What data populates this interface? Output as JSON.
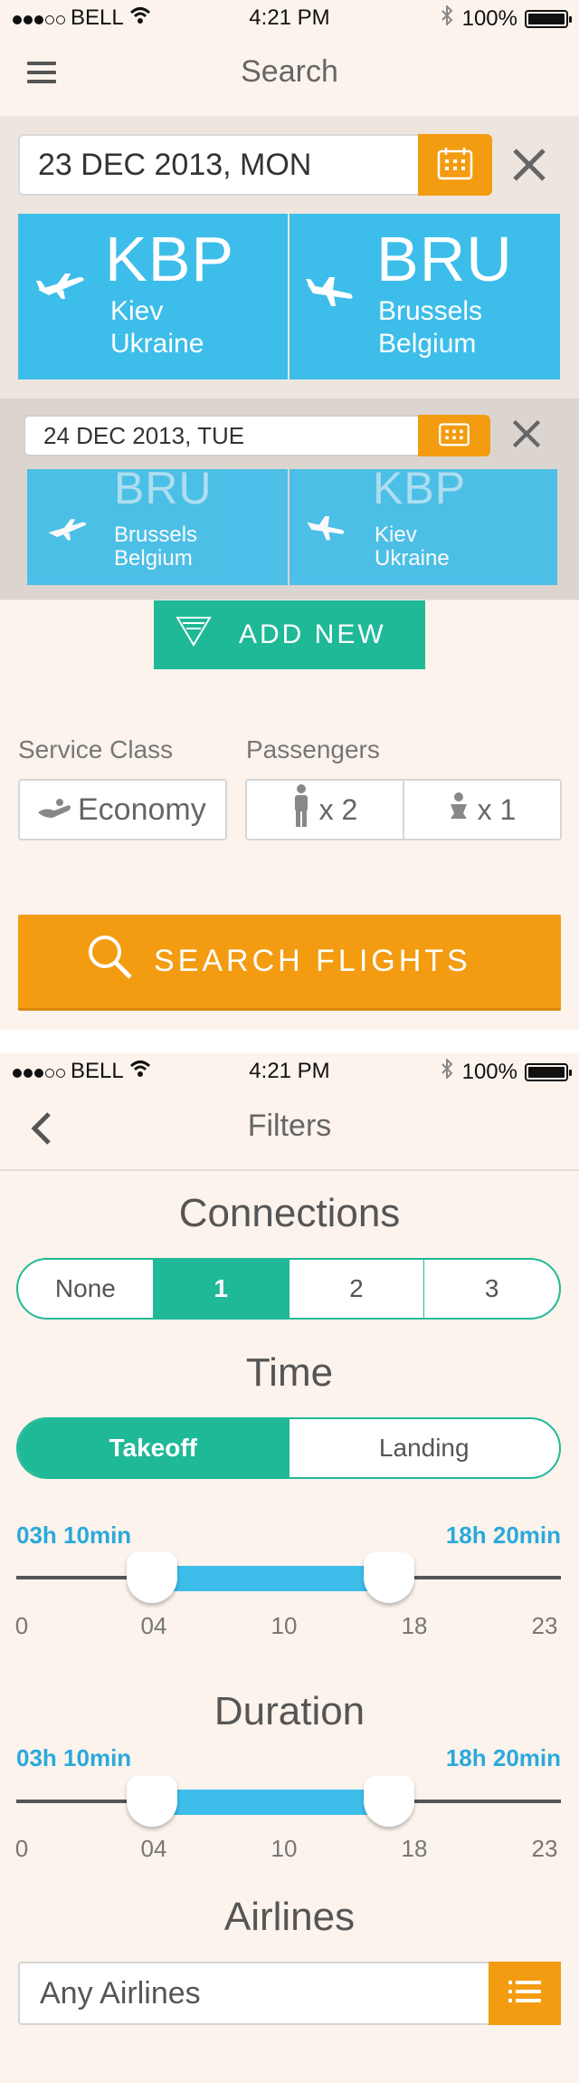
{
  "status_bar": {
    "carrier": "BELL",
    "time": "4:21 PM",
    "battery": "100%"
  },
  "search_screen": {
    "title": "Search",
    "flights": [
      {
        "date": "23 DEC 2013, MON",
        "from": {
          "code": "KBP",
          "city": "Kiev",
          "country": "Ukraine"
        },
        "to": {
          "code": "BRU",
          "city": "Brussels",
          "country": "Belgium"
        }
      },
      {
        "date": "24 DEC 2013, TUE",
        "from": {
          "code": "BRU",
          "city": "Brussels",
          "country": "Belgium"
        },
        "to": {
          "code": "KBP",
          "city": "Kiev",
          "country": "Ukraine"
        }
      }
    ],
    "add_new_label": "ADD NEW",
    "service_class_label": "Service Class",
    "service_class_value": "Economy",
    "passengers_label": "Passengers",
    "adults": "x 2",
    "infants": "x 1",
    "search_button": "SEARCH FLIGHTS"
  },
  "filters_screen": {
    "title": "Filters",
    "connections": {
      "title": "Connections",
      "options": [
        "None",
        "1",
        "2",
        "3"
      ],
      "selected": "1"
    },
    "time": {
      "title": "Time",
      "options": [
        "Takeoff",
        "Landing"
      ],
      "selected": "Takeoff",
      "range_min": "03h 10min",
      "range_max": "18h 20min",
      "ticks": [
        "0",
        "04",
        "10",
        "18",
        "23"
      ]
    },
    "duration": {
      "title": "Duration",
      "range_min": "03h 10min",
      "range_max": "18h 20min",
      "ticks": [
        "0",
        "04",
        "10",
        "18",
        "23"
      ]
    },
    "airlines": {
      "title": "Airlines",
      "value": "Any Airlines"
    }
  },
  "colors": {
    "orange": "#f39c12",
    "blue": "#3dbdea",
    "green": "#1fb997",
    "background": "#fbf3ec"
  }
}
